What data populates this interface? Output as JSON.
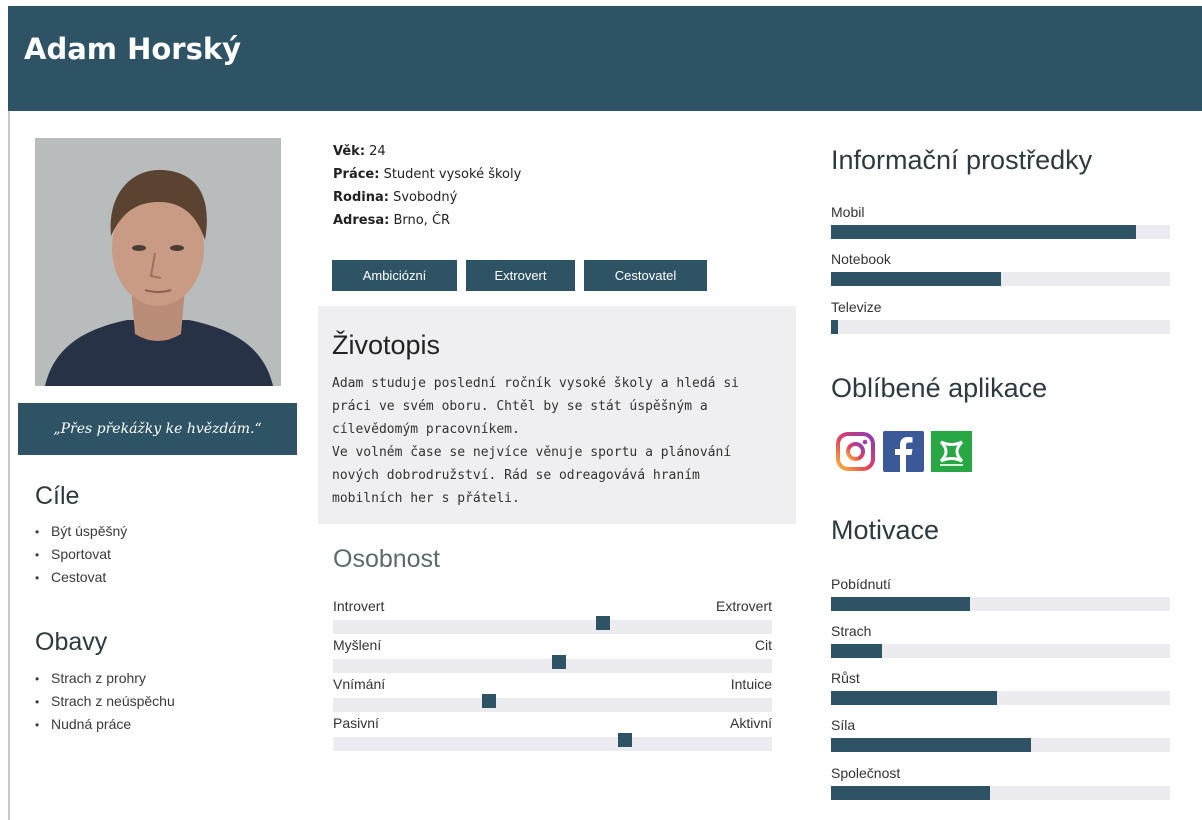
{
  "header": {
    "name": "Adam Horský"
  },
  "quote": "„Přes překážky ke hvězdám.“",
  "goals": {
    "title": "Cíle",
    "items": [
      "Být úspěšný",
      "Sportovat",
      "Cestovat"
    ]
  },
  "concerns": {
    "title": "Obavy",
    "items": [
      "Strach z prohry",
      "Strach z neúspěchu",
      "Nudná práce"
    ]
  },
  "info": [
    {
      "label": "Věk:",
      "value": "24"
    },
    {
      "label": "Práce:",
      "value": "Student vysoké školy"
    },
    {
      "label": "Rodina:",
      "value": "Svobodný"
    },
    {
      "label": "Adresa:",
      "value": "Brno, ČR"
    }
  ],
  "traits": [
    "Ambiciózní",
    "Extrovert",
    "Cestovatel"
  ],
  "bio": {
    "title": "Životopis",
    "text": " Adam  studuje poslední ročník vysoké školy a hledá si\npráci ve svém oboru. Chtěl by se stát úspěšným a\ncílevědomým pracovníkem.\nVe volném čase se nejvíce věnuje sportu a plánování\nnových dobrodružství. Rád se odreagovává hraním\nmobilních her s přáteli."
  },
  "personality": {
    "title": "Osobnost",
    "sliders": [
      {
        "left": "Introvert",
        "right": "Extrovert",
        "value": 0.615
      },
      {
        "left": "Myšlení",
        "right": "Cit",
        "value": 0.515
      },
      {
        "left": "Vnímání",
        "right": "Intuice",
        "value": 0.355
      },
      {
        "left": "Pasivní",
        "right": "Aktivní",
        "value": 0.665
      }
    ]
  },
  "media": {
    "title": "Informační prostředky",
    "bars": [
      {
        "label": "Mobil",
        "value": 0.9
      },
      {
        "label": "Notebook",
        "value": 0.5
      },
      {
        "label": "Televize",
        "value": 0.02
      }
    ]
  },
  "apps": {
    "title": "Oblíbené aplikace",
    "icons": [
      "instagram-icon",
      "facebook-icon",
      "under-armour-icon"
    ]
  },
  "motivation": {
    "title": "Motivace",
    "bars": [
      {
        "label": "Pobídnutí",
        "value": 0.41
      },
      {
        "label": "Strach",
        "value": 0.15
      },
      {
        "label": "Růst",
        "value": 0.49
      },
      {
        "label": "Síla",
        "value": 0.59
      },
      {
        "label": "Společnost",
        "value": 0.47
      }
    ]
  },
  "colors": {
    "accent": "#2e5365",
    "track": "#ececf0",
    "panel": "#efeff1"
  }
}
